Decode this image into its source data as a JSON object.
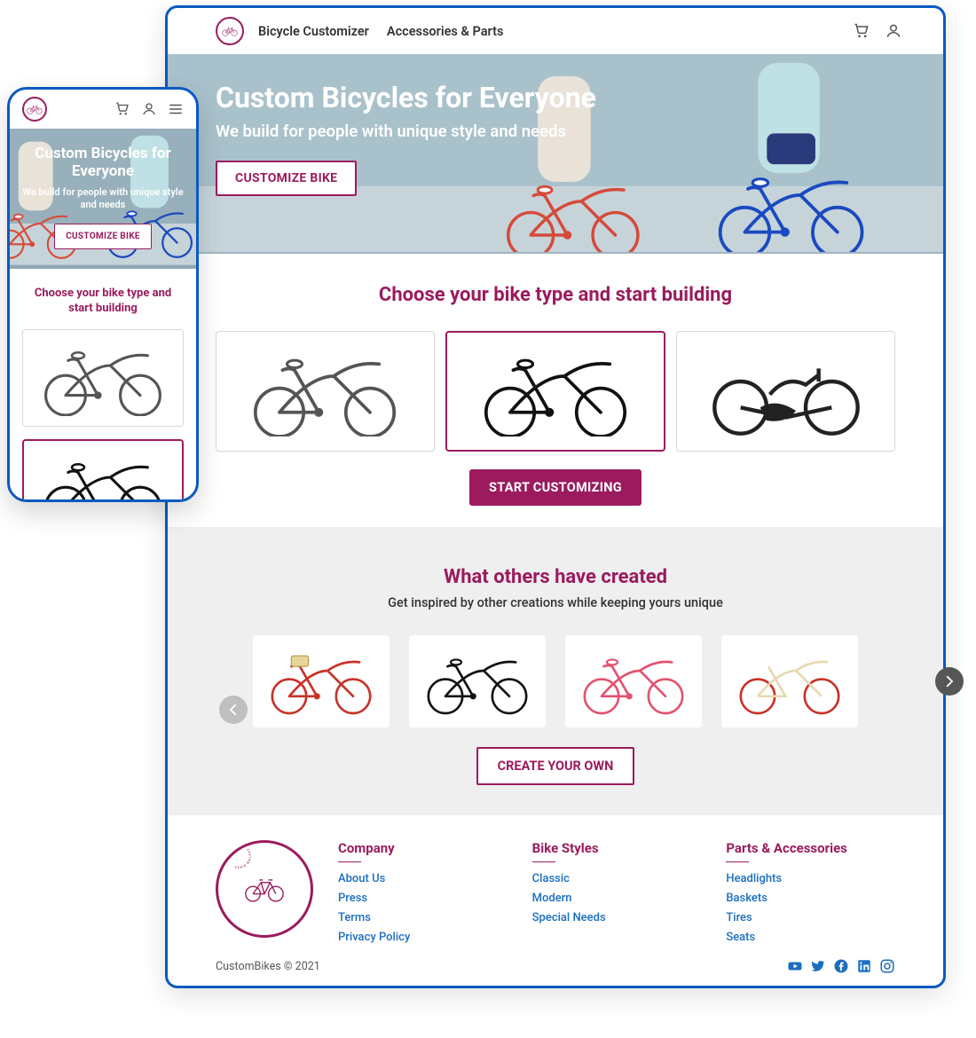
{
  "brand": {
    "name": "Custom Bikes"
  },
  "nav": {
    "links": [
      "Bicycle Customizer",
      "Accessories & Parts"
    ]
  },
  "hero": {
    "title": "Custom Bicycles for Everyone",
    "subtitle": "We build for people with unique style and needs",
    "cta": "CUSTOMIZE BIKE"
  },
  "choose": {
    "heading": "Choose your bike type and start building",
    "cta": "START CUSTOMIZING",
    "options": [
      {
        "id": "cruiser-white",
        "selected": false
      },
      {
        "id": "cruiser-black",
        "selected": true
      },
      {
        "id": "handcycle",
        "selected": false
      }
    ]
  },
  "gallery": {
    "heading": "What others have created",
    "subtitle": "Get inspired by other creations while keeping yours unique",
    "cta": "CREATE YOUR OWN",
    "items": [
      {
        "id": "red-basket"
      },
      {
        "id": "black-cruiser"
      },
      {
        "id": "pink-cruiser"
      },
      {
        "id": "cream-red"
      }
    ]
  },
  "footer": {
    "columns": [
      {
        "title": "Company",
        "links": [
          "About Us",
          "Press",
          "Terms",
          "Privacy Policy"
        ]
      },
      {
        "title": "Bike Styles",
        "links": [
          "Classic",
          "Modern",
          "Special Needs"
        ]
      },
      {
        "title": "Parts & Accessories",
        "links": [
          "Headlights",
          "Baskets",
          "Tires",
          "Seats"
        ]
      }
    ],
    "copyright": "CustomBikes © 2021",
    "socials": [
      "youtube",
      "twitter",
      "facebook",
      "linkedin",
      "instagram"
    ]
  },
  "mobile": {
    "hero_title": "Custom Bicycles for Everyone",
    "hero_sub": "We build for people with unique style and needs",
    "hero_cta": "CUSTOMIZE BIKE",
    "choose_heading": "Choose your bike type and start building"
  },
  "colors": {
    "accent": "#9b1b5e",
    "frame": "#0a5ac0",
    "link": "#1a6ec0"
  }
}
